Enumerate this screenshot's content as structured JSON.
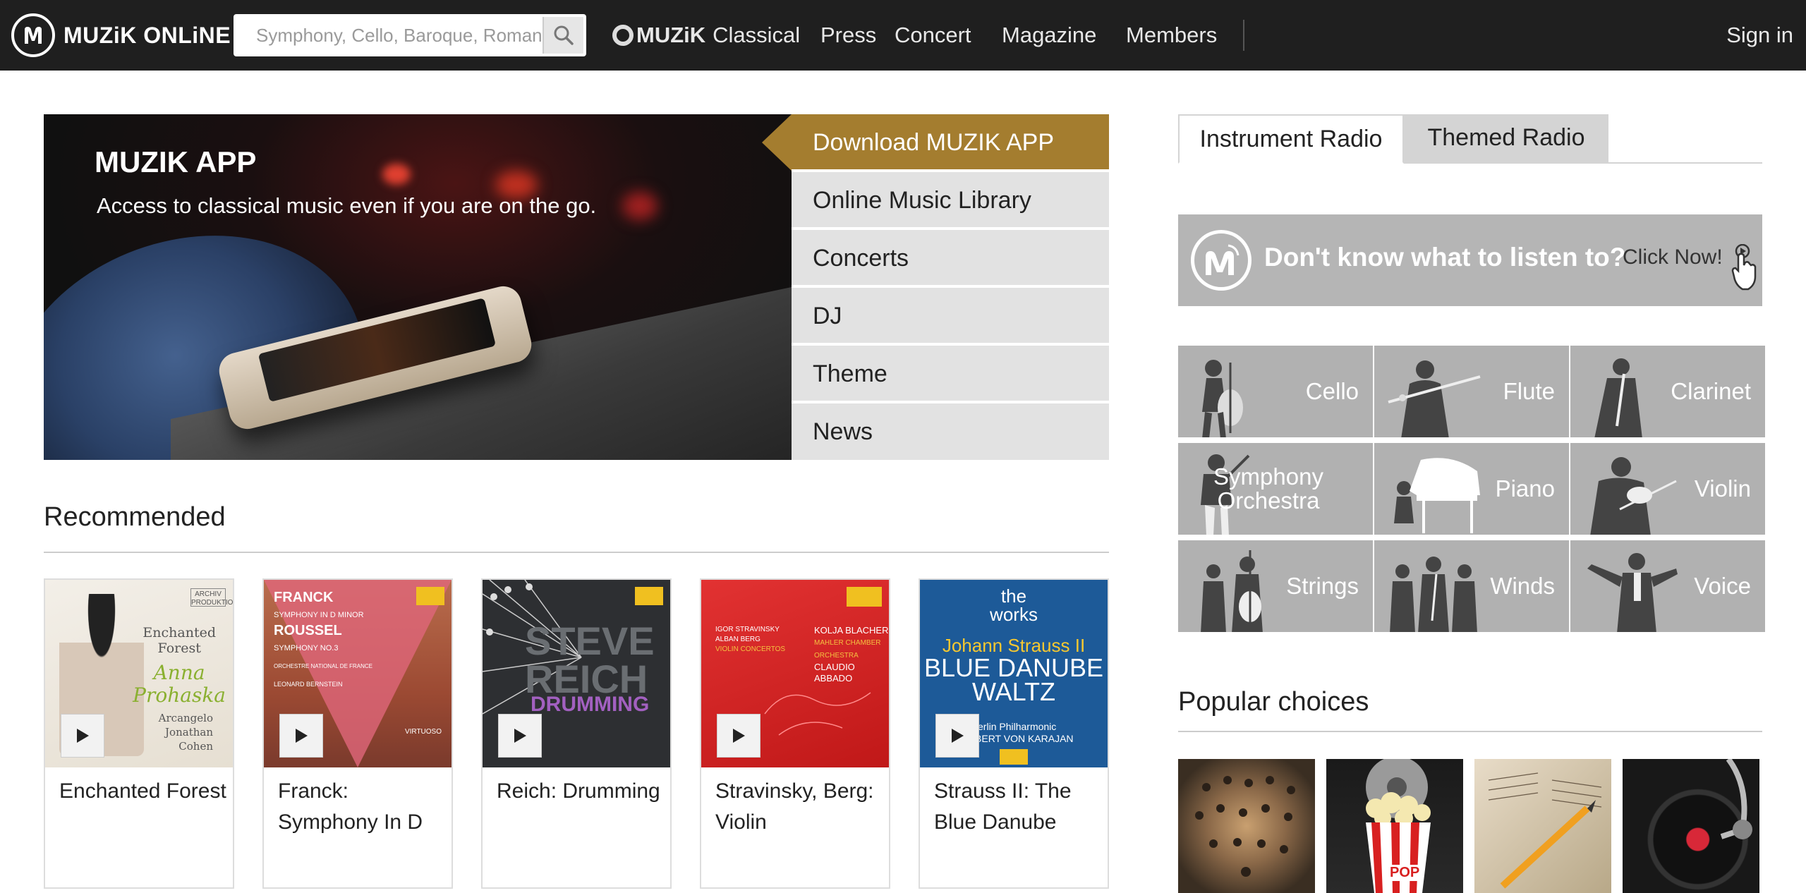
{
  "topbar": {
    "logo_text": "MUZiK ONLiNE",
    "search_placeholder": "Symphony, Cello, Baroque, Romantic",
    "brand_bold": "MUZiK",
    "brand_rest": "Classical",
    "nav": [
      "Press",
      "Concert",
      "Magazine",
      "Members"
    ],
    "signin": "Sign in"
  },
  "hero": {
    "title": "MUZIK APP",
    "subtitle": "Access to classical music even if you are on the go.",
    "menu": [
      "Download MUZIK APP",
      "Online Music Library",
      "Concerts",
      "DJ",
      "Theme",
      "News"
    ],
    "accent_color": "#a47d2f"
  },
  "recommended": {
    "title": "Recommended",
    "items": [
      {
        "title": "Enchanted Forest"
      },
      {
        "title": "Franck: Symphony In D"
      },
      {
        "title": "Reich: Drumming"
      },
      {
        "title": "Stravinsky, Berg: Violin"
      },
      {
        "title": "Strauss II: The Blue Danube"
      }
    ],
    "covers": {
      "c1": {
        "badge": "ARCHIV PRODUKTION",
        "line1": "Enchanted",
        "line2": "Forest",
        "name1": "Anna",
        "name2": "Prohaska",
        "sub1": "Arcangelo",
        "sub2": "Jonathan",
        "sub3": "Cohen"
      },
      "c2": {
        "a": "FRANCK",
        "b": "SYMPHONY IN D MINOR",
        "c": "ROUSSEL",
        "d": "SYMPHONY NO.3",
        "e": "ORCHESTRE NATIONAL DE FRANCE",
        "f": "LEONARD BERNSTEIN",
        "g": "VIRTUOSO"
      },
      "c3": {
        "a": "STEVE",
        "b": "REICH",
        "c": "DRUMMING"
      },
      "c4": {
        "a": "IGOR STRAVINSKY",
        "b": "ALBAN BERG",
        "c": "VIOLIN CONCERTOS",
        "d": "KOLJA BLACHER",
        "e": "MAHLER CHAMBER ORCHESTRA",
        "f": "CLAUDIO ABBADO"
      },
      "c5": {
        "a": "the",
        "b": "works",
        "c": "Johann Strauss II",
        "d": "BLUE DANUBE",
        "e": "WALTZ",
        "f": "Berlin Philharmonic",
        "g": "HERBERT VON KARAJAN"
      }
    }
  },
  "radio": {
    "tabs": [
      "Instrument Radio",
      "Themed Radio"
    ],
    "promo_question": "Don't know what to listen to?",
    "promo_cta": "Click Now!",
    "instruments": [
      "Cello",
      "Flute",
      "Clarinet",
      "Symphony Orchestra",
      "Piano",
      "Violin",
      "Strings",
      "Winds",
      "Voice"
    ]
  },
  "popular": {
    "title": "Popular choices",
    "popcorn_text": "POP"
  }
}
